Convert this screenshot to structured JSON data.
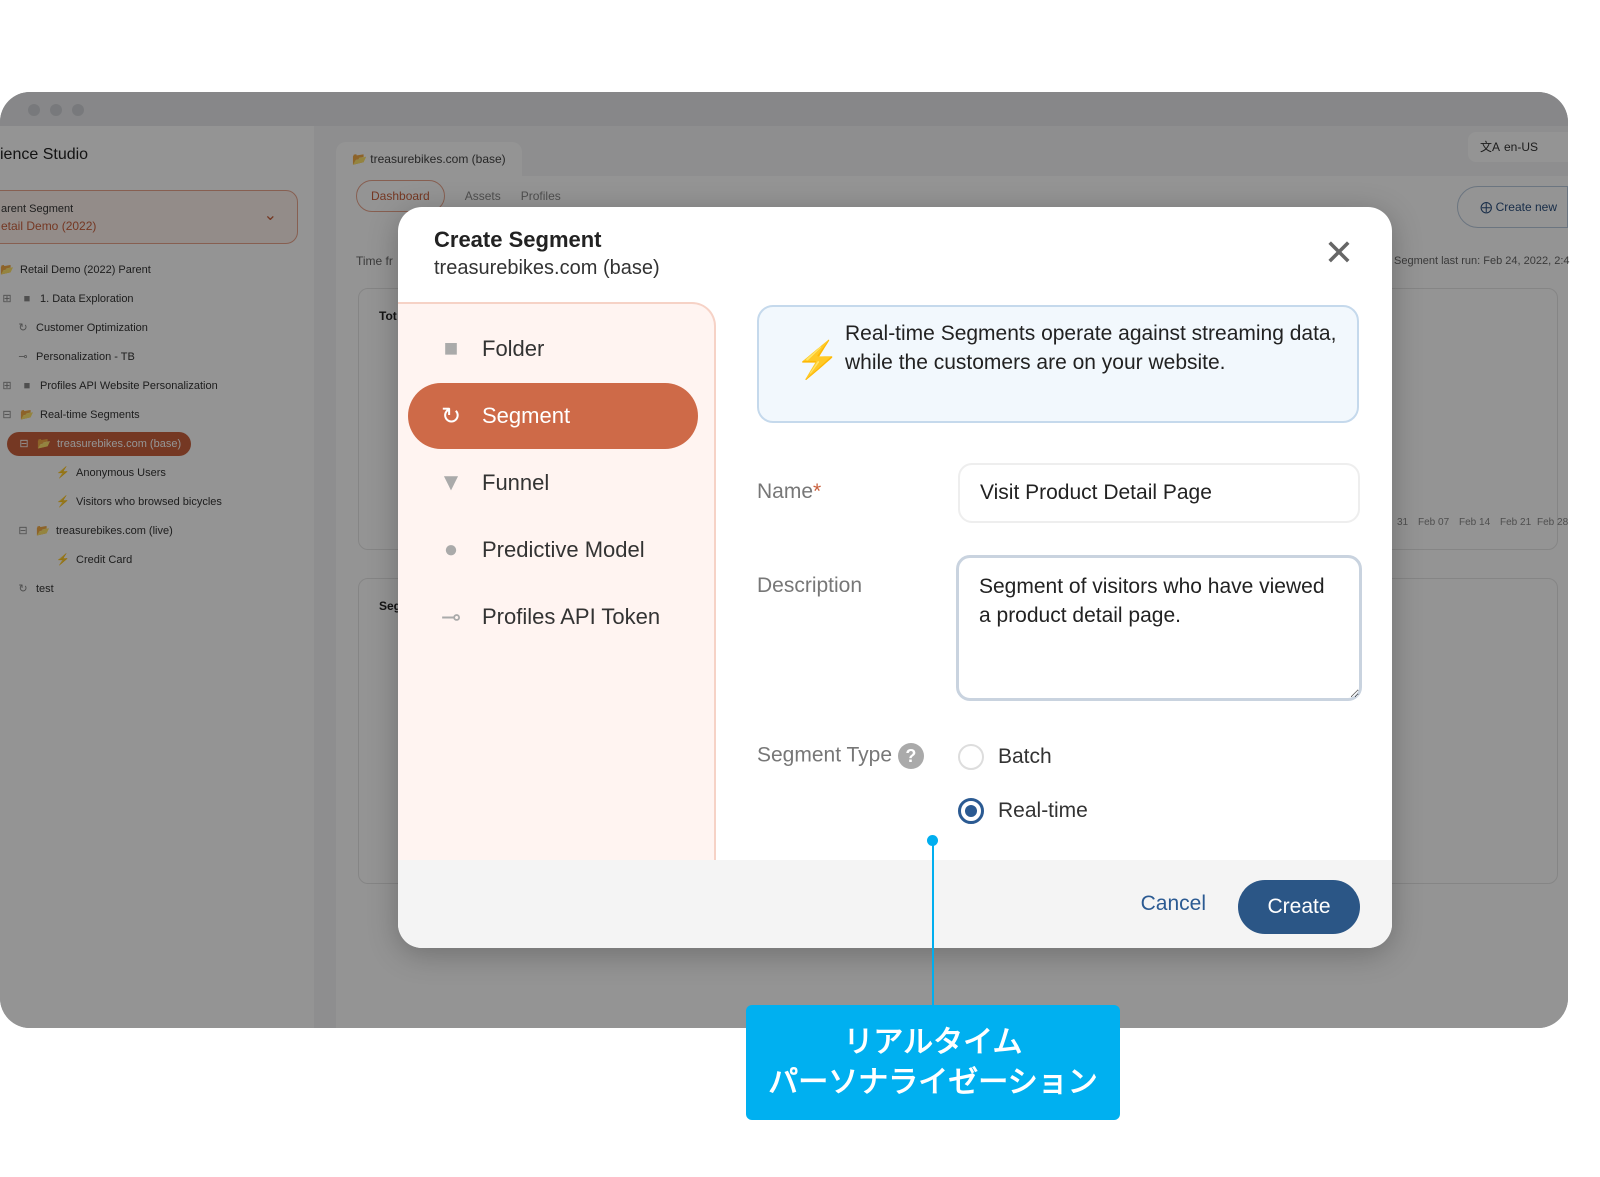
{
  "window": {
    "brand": "ience Studio"
  },
  "sidebar": {
    "parent_segment_label": "arent Segment",
    "parent_segment_value": "etail Demo (2022)",
    "tree": [
      {
        "label": "Retail Demo (2022) Parent",
        "icon": "folder-open-icon"
      },
      {
        "label": "1. Data Exploration",
        "icon": "folder-icon"
      },
      {
        "label": "Customer Optimization",
        "icon": "segment-icon"
      },
      {
        "label": "Personalization - TB",
        "icon": "key-icon"
      },
      {
        "label": "Profiles API Website Personalization",
        "icon": "folder-icon"
      },
      {
        "label": "Real-time Segments",
        "icon": "folder-open-icon"
      },
      {
        "label": "treasurebikes.com (base)",
        "icon": "folder-open-icon",
        "selected": true
      },
      {
        "label": "Anonymous Users",
        "icon": "bolt-icon"
      },
      {
        "label": "Visitors who browsed bicycles",
        "icon": "bolt-icon"
      },
      {
        "label": "treasurebikes.com (live)",
        "icon": "folder-open-icon"
      },
      {
        "label": "Credit Card",
        "icon": "bolt-icon"
      },
      {
        "label": "test",
        "icon": "segment-icon"
      }
    ]
  },
  "main": {
    "tab": "treasurebikes.com (base)",
    "language": "en-US",
    "subtabs": [
      "Dashboard",
      "Assets",
      "Profiles"
    ],
    "create_new": "Create new",
    "time_frame": "Time fr",
    "last_run": "Segment last run: Feb 24, 2022, 2:4",
    "card1_title": "Tot",
    "card2_title": "Seg",
    "x_labels": [
      "31",
      "Feb 07",
      "Feb 14",
      "Feb 21",
      "Feb 28"
    ]
  },
  "modal": {
    "title": "Create Segment",
    "subtitle": "treasurebikes.com (base)",
    "types": [
      {
        "label": "Folder",
        "icon": "folder-icon"
      },
      {
        "label": "Segment",
        "icon": "segment-icon",
        "active": true
      },
      {
        "label": "Funnel",
        "icon": "funnel-icon"
      },
      {
        "label": "Predictive Model",
        "icon": "predictive-model-icon"
      },
      {
        "label": "Profiles API Token",
        "icon": "key-icon"
      }
    ],
    "info": "Real-time Segments operate against streaming data, while the customers are on your website.",
    "name_label": "Name",
    "required_mark": "*",
    "name_value": "Visit Product Detail Page",
    "description_label": "Description",
    "description_value": "Segment of visitors who have viewed a product detail page.",
    "segment_type_label": "Segment Type",
    "help": "?",
    "options": [
      {
        "label": "Batch",
        "selected": false
      },
      {
        "label": "Real-time",
        "selected": true
      }
    ],
    "cancel": "Cancel",
    "create": "Create"
  },
  "callout": {
    "line1": "リアルタイム",
    "line2": "パーソナライゼーション",
    "color": "#00b0f0"
  },
  "colors": {
    "accent": "#ce6a48",
    "primary": "#2b5686"
  }
}
